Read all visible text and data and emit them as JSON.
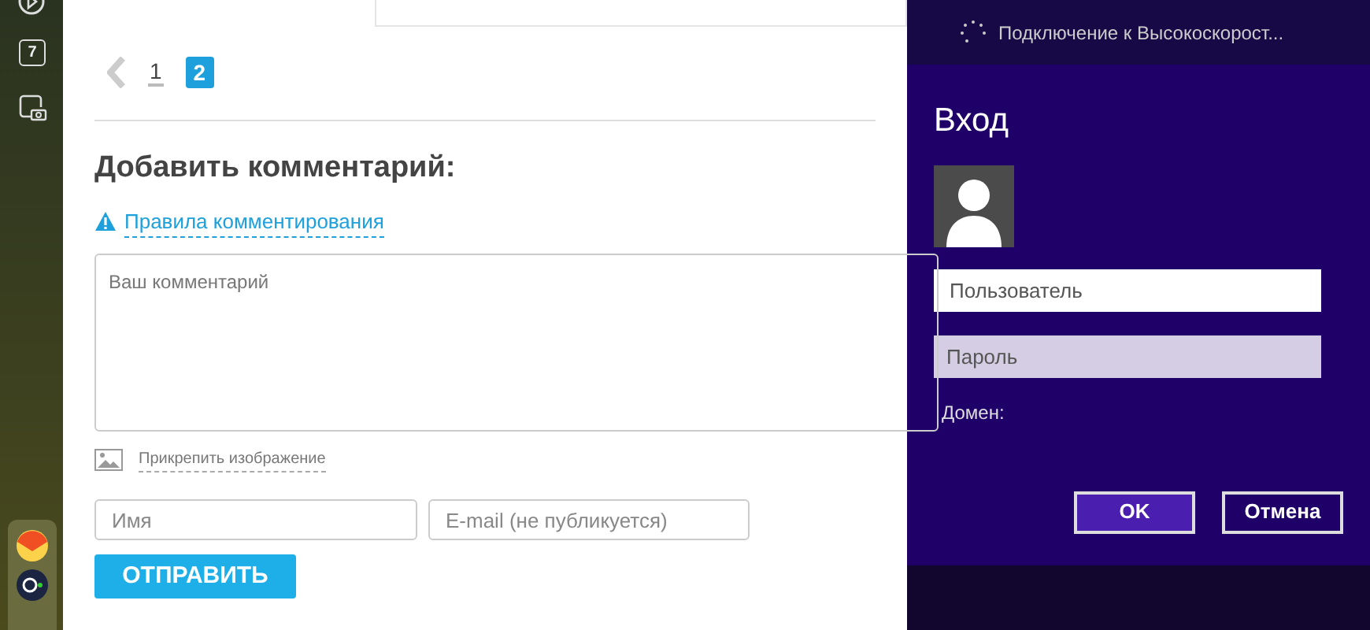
{
  "dock": {
    "calendar_day": "7"
  },
  "pagination": {
    "pages": [
      {
        "label": "1",
        "selected": false
      },
      {
        "label": "2",
        "selected": true
      }
    ]
  },
  "comment_form": {
    "title": "Добавить комментарий:",
    "rules_link": "Правила комментирования",
    "comment_placeholder": "Ваш комментарий",
    "attach_link": "Прикрепить изображение",
    "name_placeholder": "Имя",
    "email_placeholder": "E-mail (не публикуется)",
    "submit": "ОТПРАВИТЬ"
  },
  "login": {
    "status": "Подключение к Высокоскорост...",
    "title": "Вход",
    "user_placeholder": "Пользователь",
    "password_placeholder": "Пароль",
    "domain_label": "Домен:",
    "ok": "OK",
    "cancel": "Отмена"
  }
}
